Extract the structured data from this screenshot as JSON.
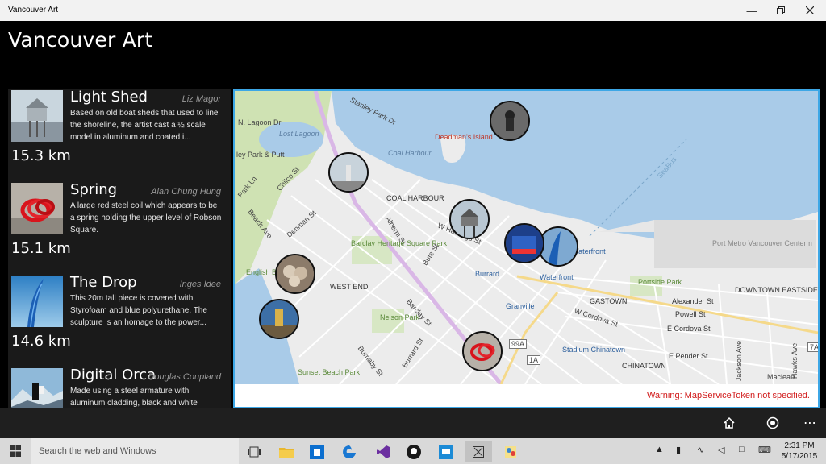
{
  "window": {
    "title": "Vancouver Art",
    "minimize_icon": "minimize-icon",
    "restore_icon": "restore-icon",
    "close_icon": "close-icon"
  },
  "app": {
    "title": "Vancouver Art"
  },
  "artworks": [
    {
      "name": "Light Shed",
      "artist": "Liz Magor",
      "description": "Based on old boat sheds that used to line the shoreline, the artist cast a ½ scale model in aluminum and coated i...",
      "distance": "15.3 km"
    },
    {
      "name": "Spring",
      "artist": "Alan Chung Hung",
      "description": "A large red steel coil which appears to be a spring holding the upper level of Robson Square.",
      "distance": "15.1 km"
    },
    {
      "name": "The Drop",
      "artist": "Inges Idee",
      "description": "This 20m tall piece is covered with Styrofoam and blue polyurethane. The sculpture is an homage to the power...",
      "distance": "14.6 km"
    },
    {
      "name": "Digital Orca",
      "artist": "Douglas Coupland",
      "description": "Made using a steel armature with aluminum cladding, black and white",
      "distance": ""
    }
  ],
  "map": {
    "warning": "Warning: MapServiceToken not specified.",
    "labels": {
      "lagoon_dr": "N. Lagoon Dr",
      "stanley_park_dr": "Stanley Park Dr",
      "lost_lagoon": "Lost Lagoon",
      "deadmans_island": "Deadman's Island",
      "coal_harbour_water": "Coal Harbour",
      "coal_harbour": "COAL HARBOUR",
      "west_end": "WEST END",
      "barclay_park": "Barclay Heritage Square Park",
      "nelson_park": "Nelson Park",
      "gastown": "GASTOWN",
      "chinatown": "CHINATOWN",
      "downtown_eastside": "DOWNTOWN EASTSIDE",
      "port_metro": "Port Metro Vancouver Centerm",
      "portside_park": "Portside Park",
      "waterfront": "Waterfront",
      "burrard": "Burrard",
      "granville": "Granville",
      "stadium_chinatown": "Stadium Chinatown",
      "alexander_st": "Alexander St",
      "powell_st": "Powell St",
      "e_cordova_st": "E Cordova St",
      "e_pender_st": "E Pender St",
      "w_cordova_st": "W Cordova St",
      "w_hastings_st": "W Hastings St",
      "alberni_st": "Alberni St",
      "bute_st": "Bute St",
      "denman_st": "Denman St",
      "chilco_st": "Chilco St",
      "beach_ave": "Beach Ave",
      "barclay_st": "Barclay St",
      "burrard_st": "Burrard St",
      "burnaby_st": "Burnaby St",
      "sunset_beach_park": "Sunset Beach Park",
      "english_bay": "English Bay",
      "jackson_ave": "Jackson Ave",
      "hawks_ave": "Hawks Ave",
      "maclean": "Maclean",
      "seabus": "SeaBus",
      "park_ln": "Park Ln",
      "route_99a": "99A",
      "route_1a": "1A",
      "route_7a": "7A",
      "devonian": "ley Park & Putt"
    }
  },
  "appbar": {
    "home_icon": "home-icon",
    "location_icon": "location-icon",
    "more_icon": "more-icon"
  },
  "taskbar": {
    "search_placeholder": "Search the web and Windows",
    "time": "2:31 PM",
    "date": "5/17/2015"
  }
}
